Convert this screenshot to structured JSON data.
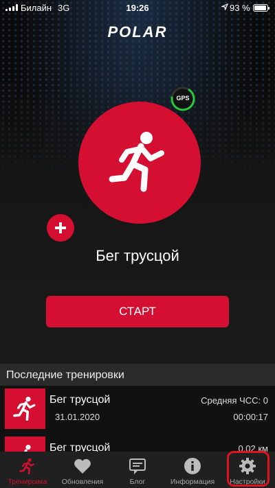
{
  "status_bar": {
    "carrier": "Билайн",
    "network": "3G",
    "time": "19:26",
    "battery_percent": "93 %",
    "battery_level": 0.93
  },
  "header": {
    "logo_text": "POLAR"
  },
  "gps": {
    "label": "GPS",
    "status_color": "#27c83a"
  },
  "sport": {
    "name": "Бег трусцой",
    "icon": "running-person-icon"
  },
  "actions": {
    "add_icon": "plus-icon",
    "start_label": "СТАРТ"
  },
  "recent": {
    "title": "Последние тренировки",
    "items": [
      {
        "name": "Бег трусцой",
        "date": "31.01.2020",
        "metric": "Средняя ЧСС: 0",
        "duration": "00:00:17"
      },
      {
        "name": "Бег трусцой",
        "date": "",
        "metric": "0,02 км",
        "duration": ""
      }
    ]
  },
  "tabbar": {
    "tabs": [
      {
        "label": "Тренировка",
        "icon": "running-icon",
        "active": true
      },
      {
        "label": "Обновления",
        "icon": "heart-icon",
        "active": false
      },
      {
        "label": "Блог",
        "icon": "chat-icon",
        "active": false
      },
      {
        "label": "Информация",
        "icon": "info-icon",
        "active": false
      },
      {
        "label": "Настройки",
        "icon": "gear-icon",
        "active": false
      }
    ]
  },
  "colors": {
    "accent": "#d50f32",
    "highlight": "#e0141e",
    "tab_bar": "#202020"
  }
}
